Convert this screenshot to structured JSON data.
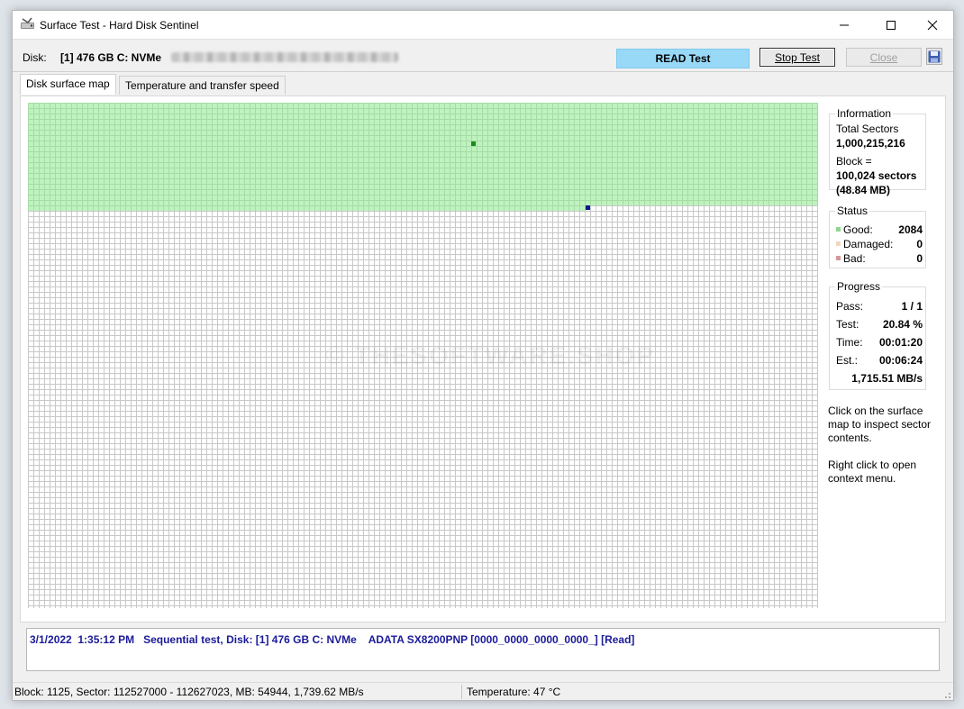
{
  "window": {
    "title": "Surface Test - Hard Disk Sentinel",
    "icon": "hdd-sentinel-icon"
  },
  "diskbar": {
    "label": "Disk:",
    "value": "[1] 476 GB C: NVMe",
    "mode": "READ Test",
    "stop_label": "Stop Test",
    "close_label": "Close",
    "save_icon": "floppy-disk-icon"
  },
  "tabs": [
    {
      "label": "Disk surface map",
      "active": true
    },
    {
      "label": "Temperature and transfer speed",
      "active": false
    }
  ],
  "map": {
    "watermark": "© THESOFTWARE.SHOP",
    "good_color": "#bff2bf",
    "current_color": "#0a1a8a"
  },
  "info": {
    "title": "Information",
    "total_label": "Total Sectors",
    "total_value": "1,000,215,216",
    "block_label": "Block =",
    "block_value": "100,024 sectors",
    "block_mb": "(48.84 MB)"
  },
  "status": {
    "title": "Status",
    "good_label": "Good:",
    "good_value": "2084",
    "damaged_label": "Damaged:",
    "damaged_value": "0",
    "bad_label": "Bad:",
    "bad_value": "0"
  },
  "progress": {
    "title": "Progress",
    "pass_label": "Pass:",
    "pass_value": "1 / 1",
    "test_label": "Test:",
    "test_value": "20.84 %",
    "time_label": "Time:",
    "time_value": "00:01:20",
    "est_label": "Est.:",
    "est_value": "00:06:24",
    "speed": "1,715.51 MB/s"
  },
  "help": {
    "line1": "Click on the surface map to inspect sector contents.",
    "line2": "Right click to open context menu."
  },
  "log": {
    "entry": "3/1/2022  1:35:12 PM   Sequential test, Disk: [1] 476 GB C: NVMe    ADATA SX8200PNP [0000_0000_0000_0000_] [Read]"
  },
  "statusbar": {
    "block_info": "Block: 1125, Sector: 112527000 - 112627023, MB: 54944, 1,739.62 MB/s",
    "temperature": "Temperature: 47  °C"
  }
}
